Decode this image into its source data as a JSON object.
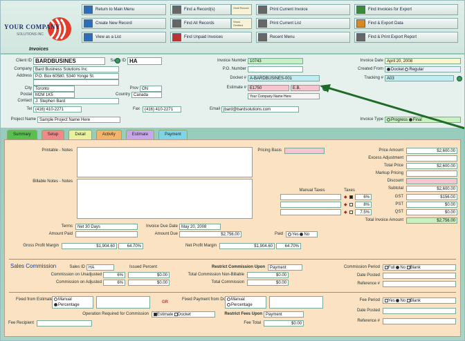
{
  "toolbar": {
    "buttons": [
      {
        "label": "Return to Main Menu"
      },
      {
        "label": "Create New Record"
      },
      {
        "label": "View as a List"
      },
      {
        "label": "Find a Record(s)"
      },
      {
        "label": "Find All Records"
      },
      {
        "label": "Find Unpaid Invoices"
      },
      {
        "label": "Print Current Invoice"
      },
      {
        "label": "Print Current List"
      },
      {
        "label": "Recent Menu"
      },
      {
        "label": "Find Invoices for Export"
      },
      {
        "label": "Find & Export Data"
      },
      {
        "label": "Find & Print Export Report"
      }
    ],
    "mini_1": "Omit Record",
    "mini_2": "Show Omitted",
    "logo_word": "YOUR COMPANY",
    "logo_sub": "SOLUTIONS INC",
    "section_title": "Invoices"
  },
  "header": {
    "client_id_label": "Client ID",
    "client_id": "BARDBUSINES",
    "sales_id_label": "Sales ID",
    "sales_id": "HA",
    "company_label": "Company",
    "company": "Bard Business Solutions Inc",
    "address_label": "Address",
    "address_1": "P.O. Box 60580, 5340 Yonge St.",
    "address_2": "",
    "city_label": "City",
    "city": "Toronto",
    "prov_label": "Prov",
    "prov": "ON",
    "postal_label": "Postal",
    "postal": "M2M 1K5",
    "country_label": "Country",
    "country": "Canada",
    "contact_label": "Contact",
    "contact": "J. Stephen Bard",
    "tel_label": "Tel",
    "tel": "(416) 410-2271",
    "fax_label": "Fax",
    "fax": "(416) 410-2271",
    "email_label": "Email",
    "email": "jbard@bardsolutions.com",
    "project_label": "Project Name",
    "project": "Sample Project Name Here",
    "invoice_number_label": "Invoice Number",
    "invoice_number": "10743",
    "po_number_label": "P.O. Number",
    "po_number": "",
    "docket_label": "Docket #",
    "docket": "A-BARDBUSINES-001",
    "estimate_label": "Estimate #",
    "estimate": "E1750",
    "estimate_suffix": "E.B.",
    "dropdown_hint": "Your Company Name Here",
    "invoice_date_label": "Invoice Date",
    "invoice_date": "April 20, 2008",
    "created_from_label": "Created From",
    "created_docket": "Docket",
    "created_regular": "Regular",
    "tracking_label": "Tracking #",
    "tracking": "A03",
    "invoice_type_label": "Invoice Type",
    "invoice_type_a": "Progress",
    "invoice_type_b": "Final"
  },
  "tabs": [
    {
      "label": "Summary",
      "color": "#5bbf4f"
    },
    {
      "label": "Setup",
      "color": "#f08a8a"
    },
    {
      "label": "Detail",
      "color": "#e8f2a0"
    },
    {
      "label": "Activity",
      "color": "#f2b46a"
    },
    {
      "label": "Estimate",
      "color": "#c6a8e8"
    },
    {
      "label": "Payment",
      "color": "#7fd4e6"
    }
  ],
  "detail": {
    "printable_notes_label": "Printable - Notes",
    "billable_notes_label": "Billable Notes - Notes",
    "pricing_basis_label": "Pricing Basis",
    "price_amount_label": "Price Amount",
    "price_amount": "$2,600.00",
    "excess_adjustment_label": "Excess Adjustment",
    "excess_adjustment": "",
    "total_price_label": "Total Price",
    "total_price": "$2,600.00",
    "markup_label": "Markup Pricing",
    "markup": "",
    "discount_label": "Discount",
    "discount": "",
    "subtotal_label": "Subtotal",
    "subtotal": "$2,600.00",
    "tax1_label": "GST",
    "tax1_rate": "6%",
    "tax1": "$156.00",
    "tax2_label": "PST",
    "tax2_rate": "8%",
    "tax2": "$0.00",
    "tax3_label": "QST",
    "tax3_rate": "7.5%",
    "tax3": "$0.00",
    "total_label": "Total Invoice Amount",
    "total": "$2,756.00",
    "manual_taxes_label": "Manual Taxes",
    "taxes_label": "Taxes",
    "terms_label": "Terms",
    "terms": "Net 30 Days",
    "invoice_due_label": "Invoice Due Date",
    "invoice_due": "May 20, 2008",
    "amount_paid_label": "Amount Paid",
    "amount_paid": "",
    "amount_due_label": "Amount Due",
    "amount_due": "$2,756.00",
    "paid_label": "Paid",
    "paid_yes": "Yes",
    "paid_no": "No",
    "gross_profit_label": "Gross Profit Margin",
    "gross_profit": "$1,904.60",
    "gross_pct": "64.70%",
    "net_profit_label": "Net Profit Margin",
    "net_profit": "$1,904.60",
    "net_pct": "64.70%"
  },
  "commission": {
    "title": "Sales Commission",
    "sales_id_label": "Sales ID",
    "sales_id": "HA",
    "issued_for_label": "Issued Percent",
    "commission_issued_label": "Commission on Unadjusted",
    "commission_issued_pct": "6%",
    "commission_issued": "$0.00",
    "commission_adjusted_label": "Commission on Adjusted",
    "commission_adjusted_pct": "6%",
    "commission_adjusted": "$0.00",
    "total_comm_nonbill_label": "Total Commission Non-Billable",
    "total_comm_nonbill": "$0.00",
    "total_comm_label": "Total Commission",
    "total_comm": "$0.00",
    "restrict_label": "Restrict Commission Upon",
    "restrict": "Payment",
    "period_label": "Commission Period",
    "period_full": "Full",
    "period_no": "No",
    "period_blank": "Blank",
    "date_posted_label": "Date Posted",
    "date_posted": "",
    "reference_label": "Reference #",
    "reference": ""
  },
  "footer_section": {
    "fixed_from_label": "Fixed from Estimate",
    "manual": "Manual",
    "percentage": "Percentage",
    "gr_label": "GR",
    "fixed_payment_label": "Fixed Payment from Docket",
    "manual_b": "Manual",
    "percentage_b": "Percentage",
    "operation_label": "Operation Required for Commission",
    "opt_estimate": "Estimate",
    "opt_docket": "Docket",
    "restrict_upon_label": "Restrict Fees Upon",
    "restrict_upon": "Payment",
    "fee_total_label": "Fee Total",
    "fee_total": "$0.00",
    "fee_recipient_label": "Fee Recipient",
    "fee_recipient": "",
    "fee_period_label": "Fee Period",
    "fee_yes": "Yes",
    "fee_no": "No",
    "fee_blank": "Blank",
    "date_paid_label": "Date Posted",
    "date_paid": "",
    "reference_b_label": "Reference #",
    "reference_b": ""
  }
}
